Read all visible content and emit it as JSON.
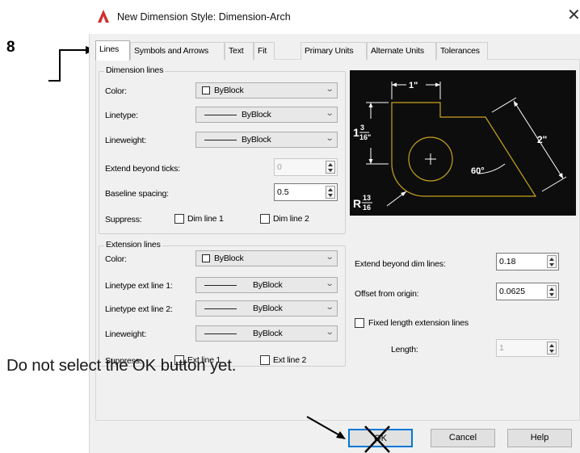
{
  "annotation": {
    "step_number": "8",
    "overlay_text": "Do not select the OK button yet."
  },
  "window": {
    "title": "New Dimension Style: Dimension-Arch",
    "close_glyph": "✕"
  },
  "tabs": [
    {
      "label": "Lines",
      "active": true
    },
    {
      "label": "Symbols and Arrows",
      "active": false
    },
    {
      "label": "Text",
      "active": false
    },
    {
      "label": "Fit",
      "active": false
    },
    {
      "label": "Primary Units",
      "active": false
    },
    {
      "label": "Alternate Units",
      "active": false
    },
    {
      "label": "Tolerances",
      "active": false
    }
  ],
  "dimension_lines": {
    "legend": "Dimension lines",
    "color_label": "Color:",
    "color_value": "ByBlock",
    "linetype_label": "Linetype:",
    "linetype_value": "ByBlock",
    "lineweight_label": "Lineweight:",
    "lineweight_value": "ByBlock",
    "extend_label": "Extend beyond ticks:",
    "extend_value": "0",
    "baseline_label": "Baseline spacing:",
    "baseline_value": "0.5",
    "suppress_label": "Suppress:",
    "dim_line1_label": "Dim line 1",
    "dim_line2_label": "Dim line 2"
  },
  "extension_lines": {
    "legend": "Extension lines",
    "color_label": "Color:",
    "color_value": "ByBlock",
    "linetype1_label": "Linetype ext line 1:",
    "linetype1_value": "ByBlock",
    "linetype2_label": "Linetype ext line 2:",
    "linetype2_value": "ByBlock",
    "lineweight_label": "Lineweight:",
    "lineweight_value": "ByBlock",
    "suppress_label": "Suppress:",
    "ext_line1_label": "Ext line 1",
    "ext_line2_label": "Ext line 2",
    "extend_beyond_label": "Extend beyond dim lines:",
    "extend_beyond_value": "0.18",
    "offset_label": "Offset from origin:",
    "offset_value": "0.0625",
    "fixed_length_label": "Fixed length extension lines",
    "length_label": "Length:",
    "length_value": "1"
  },
  "preview": {
    "dim_top": "1\"",
    "dim_left_whole": "1",
    "dim_left_num": "3",
    "dim_left_den": "16\"",
    "dim_right": "2\"",
    "angle": "60°",
    "radius_prefix": "R",
    "radius_num": "13",
    "radius_den": "16"
  },
  "buttons": {
    "ok_label": "OK",
    "cancel_label": "Cancel",
    "help_label": "Help"
  },
  "colors": {
    "accent": "#0078d7",
    "preview_bg": "#0d0d0d",
    "preview_shape": "#c8a41e",
    "logo_red": "#d22e2e"
  }
}
